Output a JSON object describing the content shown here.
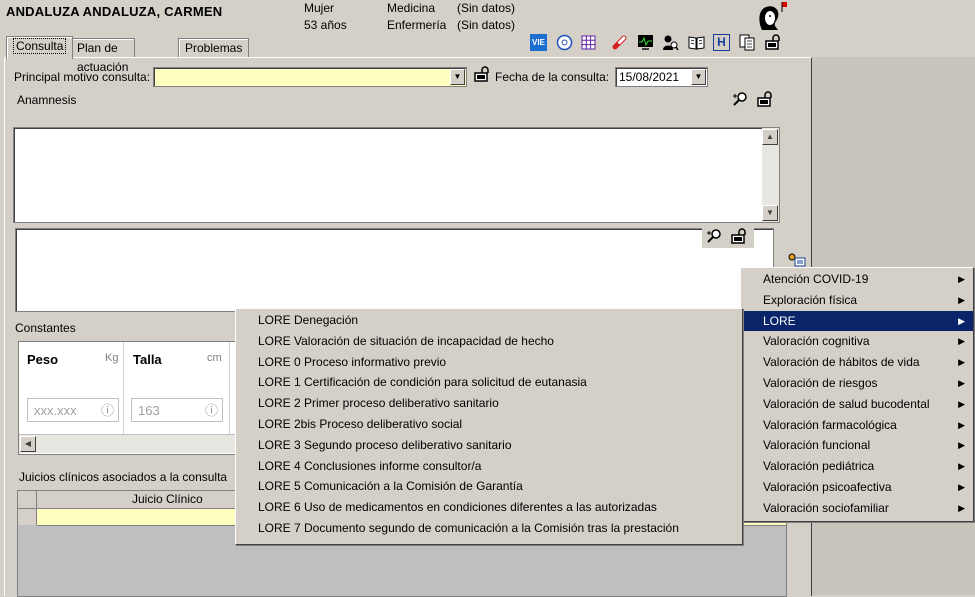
{
  "patient": {
    "name": "ANDALUZA ANDALUZA, CARMEN",
    "sex": "Mujer",
    "age": "53 años",
    "service1": "Medicina",
    "service2": "Enfermería",
    "data1": "(Sin datos)",
    "data2": "(Sin datos)"
  },
  "tabs": [
    "Consulta",
    "Plan de actuación",
    "Problemas"
  ],
  "toolbar": {
    "vie_label": "VIE",
    "h_label": "H"
  },
  "form": {
    "motivo_label": "Principal motivo consulta:",
    "motivo_value": "",
    "fecha_label": "Fecha de la consulta:",
    "fecha_value": "15/08/2021",
    "anamnesis_label": "Anamnesis"
  },
  "constantes": {
    "label": "Constantes",
    "peso_label": "Peso",
    "peso_unit": "Kg",
    "peso_placeholder": "xxx.xxx",
    "talla_label": "Talla",
    "talla_unit": "cm",
    "talla_value": "163"
  },
  "juicios": {
    "label": "Juicios clínicos asociados a la consulta",
    "col_header": "Juicio Clínico"
  },
  "main_menu": [
    "Atención COVID-19",
    "Exploración física",
    "LORE",
    "Valoración cognitiva",
    "Valoración de hábitos de vida",
    "Valoración de riesgos",
    "Valoración de salud bucodental",
    "Valoración farmacológica",
    "Valoración funcional",
    "Valoración pediátrica",
    "Valoración psicoafectiva",
    "Valoración sociofamiliar"
  ],
  "main_menu_selected": "LORE",
  "sub_menu": [
    "LORE Denegación",
    "LORE Valoración de situación de incapacidad de hecho",
    "LORE 0 Proceso informativo previo",
    "LORE 1 Certificación de condición para solicitud de eutanasia",
    "LORE 2 Primer proceso deliberativo sanitario",
    "LORE 2bis Proceso deliberativo social",
    "LORE 3 Segundo proceso deliberativo sanitario",
    "LORE 4 Conclusiones informe consultor/a",
    "LORE 5 Comunicación a la Comisión de Garantía",
    "LORE 6 Uso de medicamentos en condiciones diferentes a las autorizadas",
    "LORE 7 Documento segundo de comunicación a la Comisión tras la prestación"
  ],
  "colors": {
    "highlight": "#0a246a",
    "field_yellow": "#ffffc0",
    "face": "#d4d0c8"
  }
}
